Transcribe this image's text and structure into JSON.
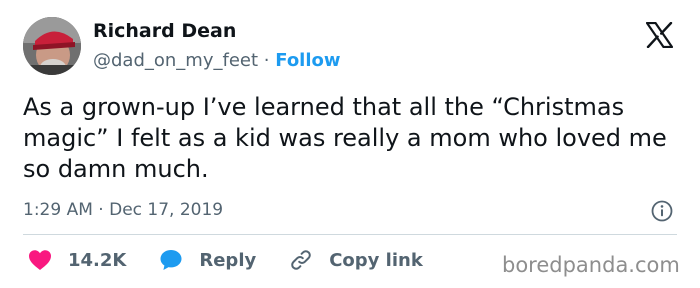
{
  "author": {
    "display_name": "Richard Dean",
    "handle": "@dad_on_my_feet",
    "separator": "·",
    "follow_label": "Follow"
  },
  "tweet": {
    "text": "As a grown-up I’ve learned that all the “Christmas magic” I felt as a kid was really a mom who loved me so damn much.",
    "time": "1:29 AM",
    "date": "Dec 17, 2019"
  },
  "actions": {
    "like_count": "14.2K",
    "reply_label": "Reply",
    "copy_label": "Copy link"
  },
  "watermark": "boredpanda.com",
  "colors": {
    "accent": "#1d9bf0",
    "like": "#f91880",
    "text": "#0f1419",
    "muted": "#536471",
    "divider": "#cfd9de"
  },
  "icons": [
    "x-logo-icon",
    "info-icon",
    "heart-icon",
    "reply-bubble-icon",
    "link-icon"
  ]
}
